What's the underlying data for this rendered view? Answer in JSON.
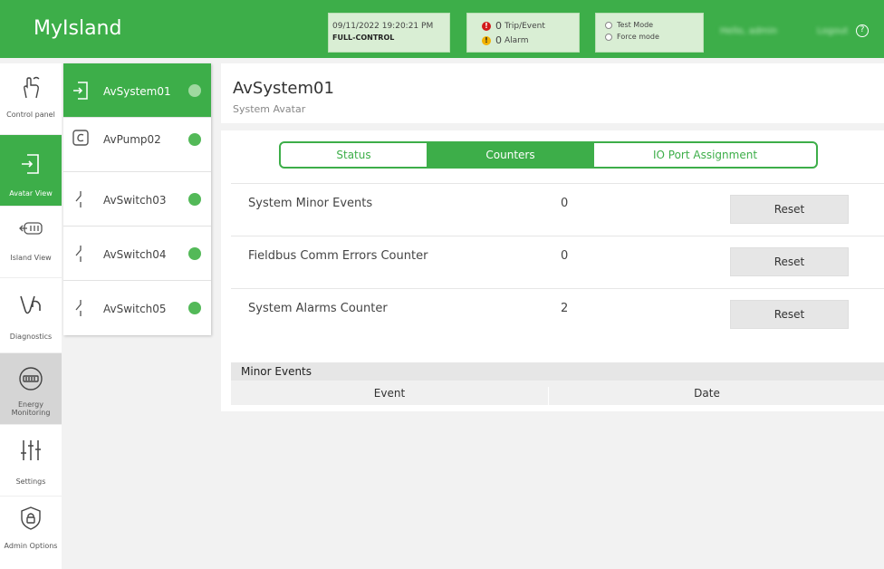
{
  "app": {
    "title": "MyIsland"
  },
  "status": {
    "datetime": "09/11/2022 19:20:21 PM",
    "mode": "FULL-CONTROL"
  },
  "alerts": {
    "trip_count": "0",
    "trip_label": "Trip/Event",
    "alarm_count": "0",
    "alarm_label": "Alarm"
  },
  "modes": {
    "test": "Test Mode",
    "force": "Force mode"
  },
  "user": {
    "greeting": "Hello, admin",
    "logout": "Logout"
  },
  "colors": {
    "primary": "#3dae49",
    "light_green": "#d9eed4"
  },
  "nav": [
    {
      "label": "Control panel",
      "icon": "hand-touch-icon"
    },
    {
      "label": "Avatar View",
      "icon": "avatar-login-icon"
    },
    {
      "label": "Island View",
      "icon": "island-icon"
    },
    {
      "label": "Diagnostics",
      "icon": "stethoscope-icon"
    },
    {
      "label": "Energy Monitoring",
      "icon": "meter-icon"
    },
    {
      "label": "Settings",
      "icon": "sliders-icon"
    },
    {
      "label": "Admin Options",
      "icon": "lock-shield-icon"
    }
  ],
  "devices": [
    {
      "name": "AvSystem01",
      "icon": "system-icon"
    },
    {
      "name": "AvPump02",
      "icon": "pump-icon"
    },
    {
      "name": "AvSwitch03",
      "icon": "switch-icon"
    },
    {
      "name": "AvSwitch04",
      "icon": "switch-icon"
    },
    {
      "name": "AvSwitch05",
      "icon": "switch-icon"
    }
  ],
  "panel": {
    "title": "AvSystem01",
    "subtitle": "System Avatar",
    "tabs": [
      "Status",
      "Counters",
      "IO Port Assignment"
    ],
    "counters": [
      {
        "label": "System Minor Events",
        "value": "0",
        "button": "Reset"
      },
      {
        "label": "Fieldbus Comm Errors Counter",
        "value": "0",
        "button": "Reset"
      },
      {
        "label": "System Alarms Counter",
        "value": "2",
        "button": "Reset"
      }
    ],
    "events": {
      "title": "Minor Events",
      "col_event": "Event",
      "col_date": "Date"
    }
  }
}
